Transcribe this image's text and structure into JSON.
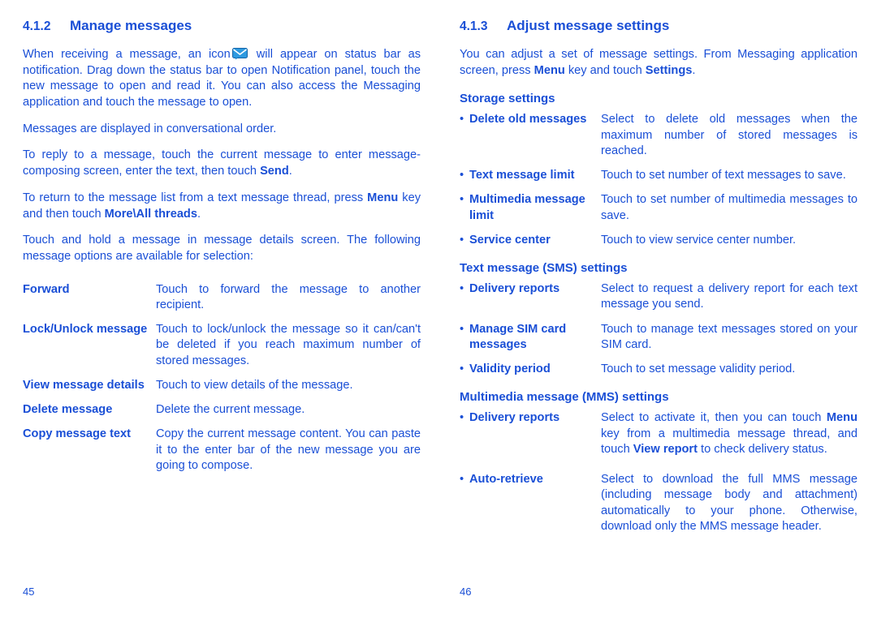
{
  "left": {
    "section": {
      "number": "4.1.2",
      "title": "Manage messages"
    },
    "para1_a": "When receiving a message, an icon",
    "para1_icon": "message-icon",
    "para1_b": "will appear on status bar as notification. Drag down the status bar to open Notification panel, touch the new message to open and read it. You can also access the Messaging application and touch the message to open.",
    "para2": "Messages are displayed in conversational order.",
    "para3_a": "To reply to a message, touch the current message to enter message-composing screen, enter the text, then touch",
    "para3_bold": "Send",
    "para3_b": ".",
    "para4_a": "To return to the message list from a text message thread, press",
    "para4_bold1": "Menu",
    "para4_b": "key and then touch",
    "para4_bold2": "More\\All threads",
    "para4_c": ".",
    "para5": "Touch and hold a message in message details screen. The following message options are available for selection:",
    "options": [
      {
        "term": "Forward",
        "desc": "Touch to forward the message to another recipient."
      },
      {
        "term": "Lock/Unlock message",
        "desc": "Touch to lock/unlock the message so it can/can't be deleted if you reach maximum number of stored messages."
      },
      {
        "term": "View message details",
        "desc": "Touch to view details of the message."
      },
      {
        "term": "Delete message",
        "desc": "Delete the current message."
      },
      {
        "term": "Copy message text",
        "desc": "Copy the current message content. You can paste it to the enter bar of the new message you are going to compose."
      }
    ],
    "page_number": "45"
  },
  "right": {
    "section": {
      "number": "4.1.3",
      "title": "Adjust message settings"
    },
    "intro_a": "You can adjust a set of message settings. From Messaging application screen, press",
    "intro_bold1": "Menu",
    "intro_b": "key and touch",
    "intro_bold2": "Settings",
    "intro_c": ".",
    "storage": {
      "heading": "Storage settings",
      "items": [
        {
          "term": "Delete old messages",
          "desc": "Select to delete old messages when the maximum number of stored messages is reached."
        },
        {
          "term": "Text message limit",
          "desc": "Touch to set number of text messages to save."
        },
        {
          "term": "Multimedia message limit",
          "desc": "Touch to set number of multimedia messages to save."
        },
        {
          "term": "Service center",
          "desc": "Touch to view service center number."
        }
      ]
    },
    "sms": {
      "heading": "Text message (SMS) settings",
      "items": [
        {
          "term": "Delivery reports",
          "desc": "Select to request a delivery report for each text message you send."
        },
        {
          "term": "Manage SIM card messages",
          "desc": "Touch to manage text messages stored on your SIM card."
        },
        {
          "term": "Validity period",
          "desc": "Touch to set message validity period."
        }
      ]
    },
    "mms": {
      "heading": "Multimedia message (MMS) settings",
      "delivery": {
        "term": "Delivery reports",
        "desc_a": "Select to activate it, then you can touch",
        "desc_bold1": "Menu",
        "desc_b": "key from a multimedia message thread, and touch",
        "desc_bold2": "View report",
        "desc_c": "to check delivery status."
      },
      "autoretrieve": {
        "term": "Auto-retrieve",
        "desc": "Select to download the full MMS message (including message body and attachment) automatically to your phone. Otherwise, download only the MMS message header."
      }
    },
    "page_number": "46"
  }
}
